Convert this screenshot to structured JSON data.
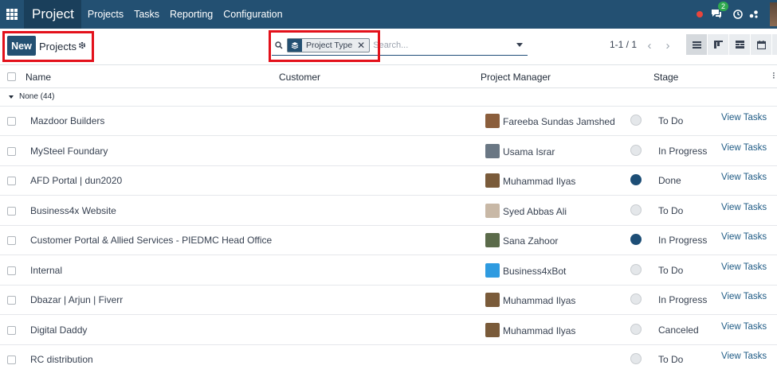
{
  "navbar": {
    "brand": "Project",
    "menu": [
      "Projects",
      "Tasks",
      "Reporting",
      "Configuration"
    ],
    "chat_badge": "2"
  },
  "control_panel": {
    "new_label": "New",
    "breadcrumb": "Projects",
    "facet_value": "Project Type",
    "search_placeholder": "Search...",
    "pager": "1-1 / 1"
  },
  "list": {
    "columns": [
      "Name",
      "Customer",
      "Project Manager",
      "Stage"
    ],
    "group_label": "None (44)",
    "rows": [
      {
        "name": "Mazdoor Builders",
        "manager": "Fareeba Sundas Jamshed",
        "status": "normal",
        "stage": "To Do",
        "action": "View Tasks",
        "avatar_color": "#8b5e3c"
      },
      {
        "name": "MySteel Foundary",
        "manager": "Usama Israr",
        "status": "normal",
        "stage": "In Progress",
        "action": "View Tasks",
        "avatar_color": "#6a7784"
      },
      {
        "name": "AFD Portal | dun2020",
        "manager": "Muhammad Ilyas",
        "status": "done",
        "stage": "Done",
        "action": "View Tasks",
        "avatar_color": "#7a5b3a"
      },
      {
        "name": "Business4x Website",
        "manager": "Syed Abbas Ali",
        "status": "normal",
        "stage": "To Do",
        "action": "View Tasks",
        "avatar_color": "#c8b8a6"
      },
      {
        "name": "Customer Portal & Allied Services - PIEDMC Head Office",
        "manager": "Sana Zahoor",
        "status": "done",
        "stage": "In Progress",
        "action": "View Tasks",
        "avatar_color": "#5b6b4a"
      },
      {
        "name": "Internal",
        "manager": "Business4xBot",
        "status": "normal",
        "stage": "To Do",
        "action": "View Tasks",
        "avatar_color": "#2f9be0"
      },
      {
        "name": "Dbazar | Arjun | Fiverr",
        "manager": "Muhammad Ilyas",
        "status": "normal",
        "stage": "In Progress",
        "action": "View Tasks",
        "avatar_color": "#7a5b3a"
      },
      {
        "name": "Digital Daddy",
        "manager": "Muhammad Ilyas",
        "status": "normal",
        "stage": "Canceled",
        "action": "View Tasks",
        "avatar_color": "#7a5b3a"
      },
      {
        "name": "RC distribution",
        "manager": "",
        "status": "normal",
        "stage": "To Do",
        "action": "View Tasks",
        "avatar_color": ""
      }
    ]
  },
  "colors": {
    "navbar": "#235072",
    "brand_bg": "#1a3f5b",
    "primary": "#235072",
    "highlight_box": "#e3111b",
    "link": "#1f5b85",
    "status_done": "#1d4e76"
  }
}
